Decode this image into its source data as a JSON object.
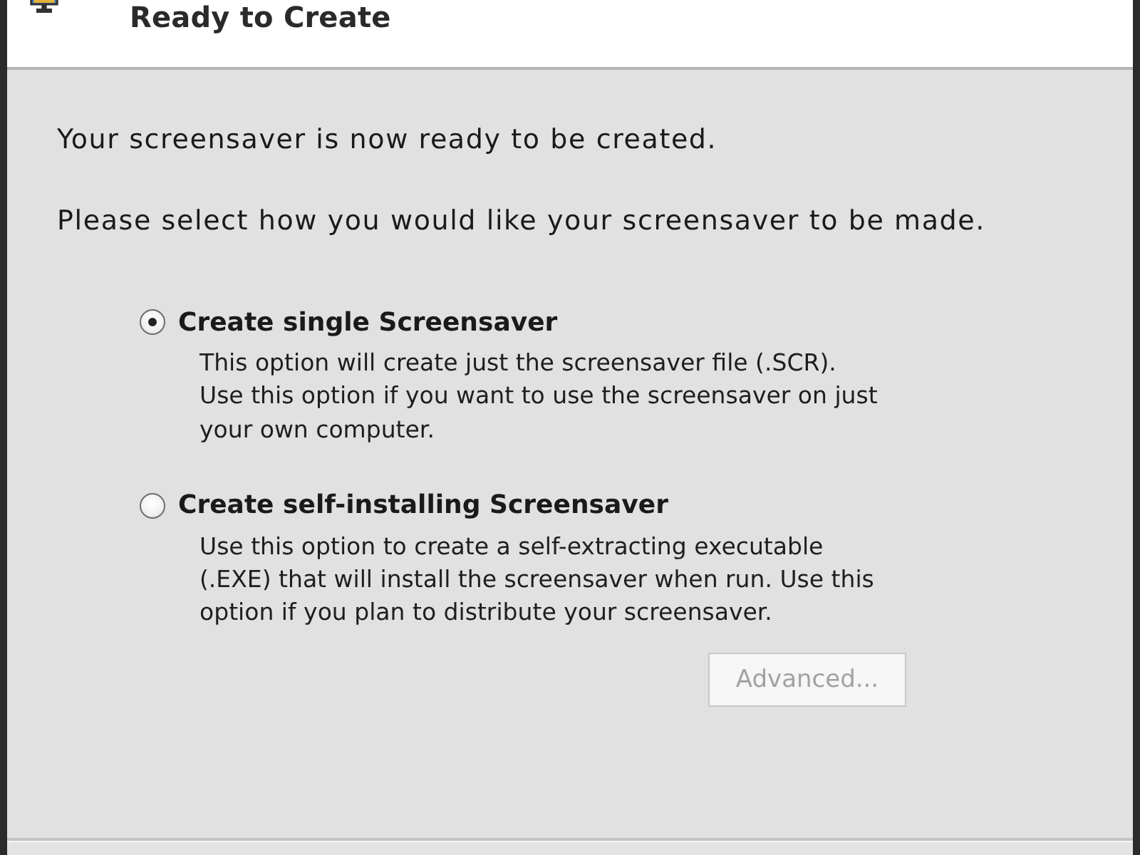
{
  "header": {
    "title": "Ready to Create"
  },
  "body": {
    "intro": "Your screensaver is now ready to be created.",
    "prompt": "Please select how you would like your screensaver to be made."
  },
  "options": [
    {
      "label": "Create single Screensaver",
      "selected": true,
      "description": [
        "This option will create just the screensaver file (.SCR).",
        "Use this option if you want to use the screensaver on just",
        "your own computer."
      ]
    },
    {
      "label": "Create self-installing Screensaver",
      "selected": false,
      "description": [
        "Use this option to create a self-extracting executable",
        "(.EXE) that will install the screensaver when run. Use this",
        "option if you plan to distribute your screensaver."
      ]
    }
  ],
  "advanced_button": {
    "label": "Advanced...",
    "disabled": true
  }
}
